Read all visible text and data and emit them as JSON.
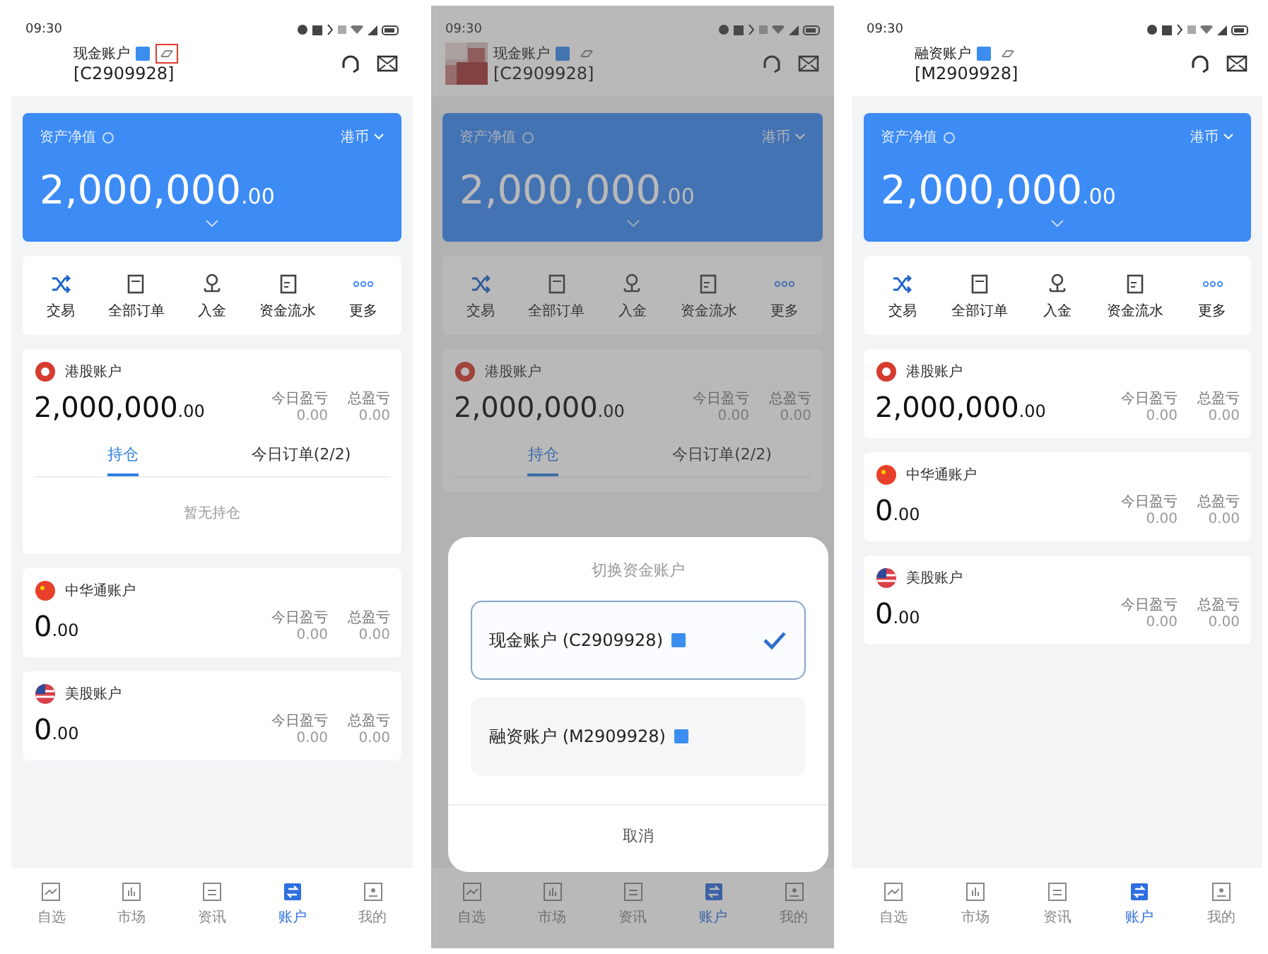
{
  "screens": [
    {
      "status_time": "09:30",
      "account": {
        "name": "现金账户",
        "id": "[C2909928]",
        "link_highlighted": true
      },
      "asset": {
        "label": "资产净值",
        "currency": "港币",
        "value": "2,000,000",
        "decimals": ".00"
      },
      "actions": [
        "交易",
        "全部订单",
        "入金",
        "资金流水",
        "更多"
      ],
      "markets": [
        {
          "name": "港股账户",
          "value": "2,000,000",
          "decimals": ".00",
          "today_label": "今日盈亏",
          "today_value": "0.00",
          "total_label": "总盈亏",
          "total_value": "0.00",
          "tabs": [
            {
              "label": "持仓",
              "selected": true
            },
            {
              "label": "今日订单(2/2)",
              "selected": false
            }
          ],
          "empty_text": "暂无持仓"
        },
        {
          "name": "中华通账户",
          "value": "0",
          "decimals": ".00",
          "today_label": "今日盈亏",
          "today_value": "0.00",
          "total_label": "总盈亏",
          "total_value": "0.00"
        },
        {
          "name": "美股账户",
          "value": "0",
          "decimals": ".00",
          "today_label": "今日盈亏",
          "today_value": "0.00",
          "total_label": "总盈亏",
          "total_value": "0.00"
        }
      ],
      "nav": [
        {
          "label": "自选",
          "selected": false
        },
        {
          "label": "市场",
          "selected": false
        },
        {
          "label": "资讯",
          "selected": false
        },
        {
          "label": "账户",
          "selected": true
        },
        {
          "label": "我的",
          "selected": false
        }
      ]
    },
    {
      "status_time": "09:30",
      "avatar": {
        "kind": "picture"
      },
      "account": {
        "name": "现金账户",
        "id": "[C2909928]",
        "link_highlighted": false
      },
      "asset": {
        "label": "资产净值",
        "currency": "港币",
        "value": "2,000,000",
        "decimals": ".00"
      },
      "actions": [
        "交易",
        "全部订单",
        "入金",
        "资金流水",
        "更多"
      ],
      "markets": [
        {
          "name": "港股账户",
          "value": "2,000,000",
          "decimals": ".00",
          "today_label": "今日盈亏",
          "today_value": "0.00",
          "total_label": "总盈亏",
          "total_value": "0.00",
          "tabs": [
            {
              "label": "持仓",
              "selected": true
            },
            {
              "label": "今日订单(2/2)",
              "selected": false
            }
          ]
        }
      ],
      "nav": [
        {
          "label": "自选",
          "selected": false
        },
        {
          "label": "市场",
          "selected": false
        },
        {
          "label": "资讯",
          "selected": false
        },
        {
          "label": "账户",
          "selected": true
        },
        {
          "label": "我的",
          "selected": false
        }
      ],
      "dialog": {
        "title": "切换资金账户",
        "options": [
          {
            "label": "现金账户 (C2909928)",
            "selected": true
          },
          {
            "label": "融资账户 (M2909928)",
            "selected": false
          }
        ],
        "cancel": "取消"
      }
    },
    {
      "status_time": "09:30",
      "account": {
        "name": "融资账户",
        "id": "[M2909928]",
        "link_highlighted": false
      },
      "asset": {
        "label": "资产净值",
        "currency": "港币",
        "value": "2,000,000",
        "decimals": ".00"
      },
      "actions": [
        "交易",
        "全部订单",
        "入金",
        "资金流水",
        "更多"
      ],
      "markets": [
        {
          "name": "港股账户",
          "value": "2,000,000",
          "decimals": ".00",
          "today_label": "今日盈亏",
          "today_value": "0.00",
          "total_label": "总盈亏",
          "total_value": "0.00"
        },
        {
          "name": "中华通账户",
          "value": "0",
          "decimals": ".00",
          "today_label": "今日盈亏",
          "today_value": "0.00",
          "total_label": "总盈亏",
          "total_value": "0.00"
        },
        {
          "name": "美股账户",
          "value": "0",
          "decimals": ".00",
          "today_label": "今日盈亏",
          "today_value": "0.00",
          "total_label": "总盈亏",
          "total_value": "0.00"
        }
      ],
      "nav": [
        {
          "label": "自选",
          "selected": false
        },
        {
          "label": "市场",
          "selected": false
        },
        {
          "label": "资讯",
          "selected": false
        },
        {
          "label": "账户",
          "selected": true
        },
        {
          "label": "我的",
          "selected": false
        }
      ]
    }
  ]
}
